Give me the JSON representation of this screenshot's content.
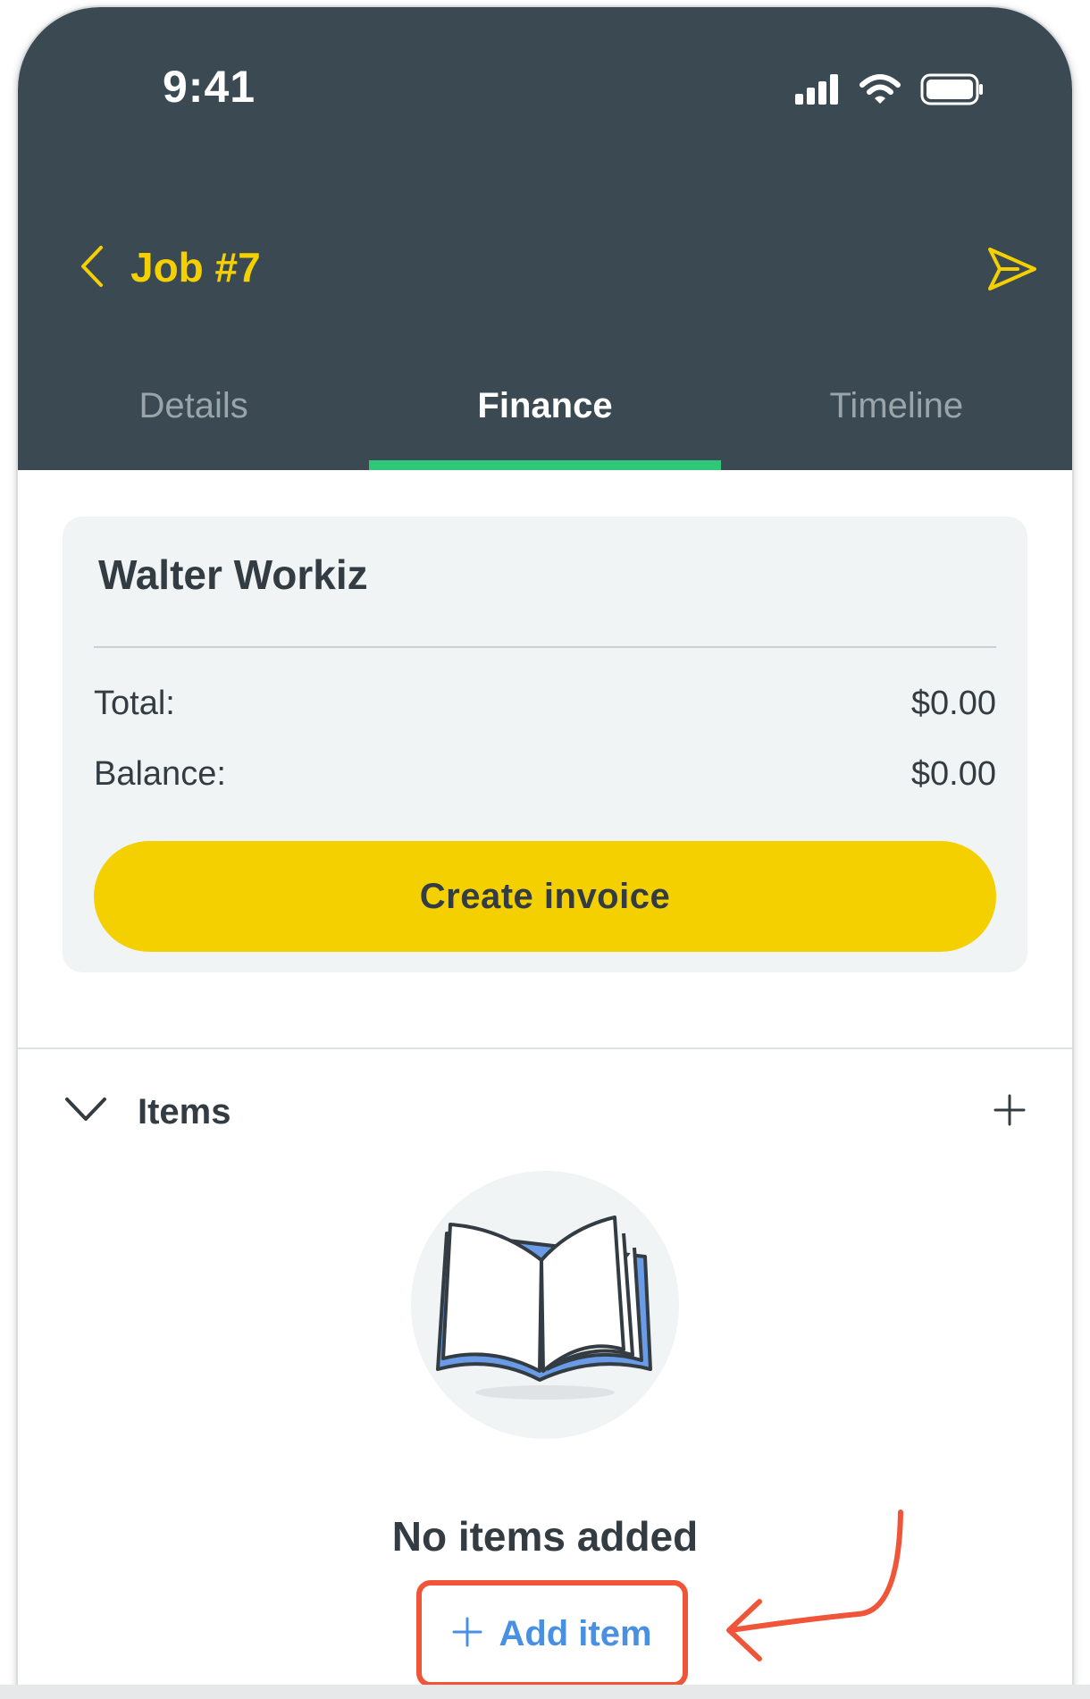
{
  "status_bar": {
    "time": "9:41"
  },
  "header": {
    "title": "Job #7",
    "back_icon": "chevron-left-icon",
    "send_icon": "send-icon"
  },
  "tabs": [
    {
      "label": "Details",
      "active": false
    },
    {
      "label": "Finance",
      "active": true
    },
    {
      "label": "Timeline",
      "active": false
    }
  ],
  "summary": {
    "customer_name": "Walter Workiz",
    "total_label": "Total:",
    "total_value": "$0.00",
    "balance_label": "Balance:",
    "balance_value": "$0.00",
    "create_invoice_label": "Create invoice"
  },
  "items_section": {
    "title": "Items",
    "empty_text": "No items added",
    "add_item_label": "Add item"
  },
  "colors": {
    "header_bg": "#3b4a52",
    "accent_yellow": "#f5d000",
    "tab_underline": "#2ec878",
    "link_blue": "#4a90e2",
    "annotation_red": "#f0553a"
  }
}
